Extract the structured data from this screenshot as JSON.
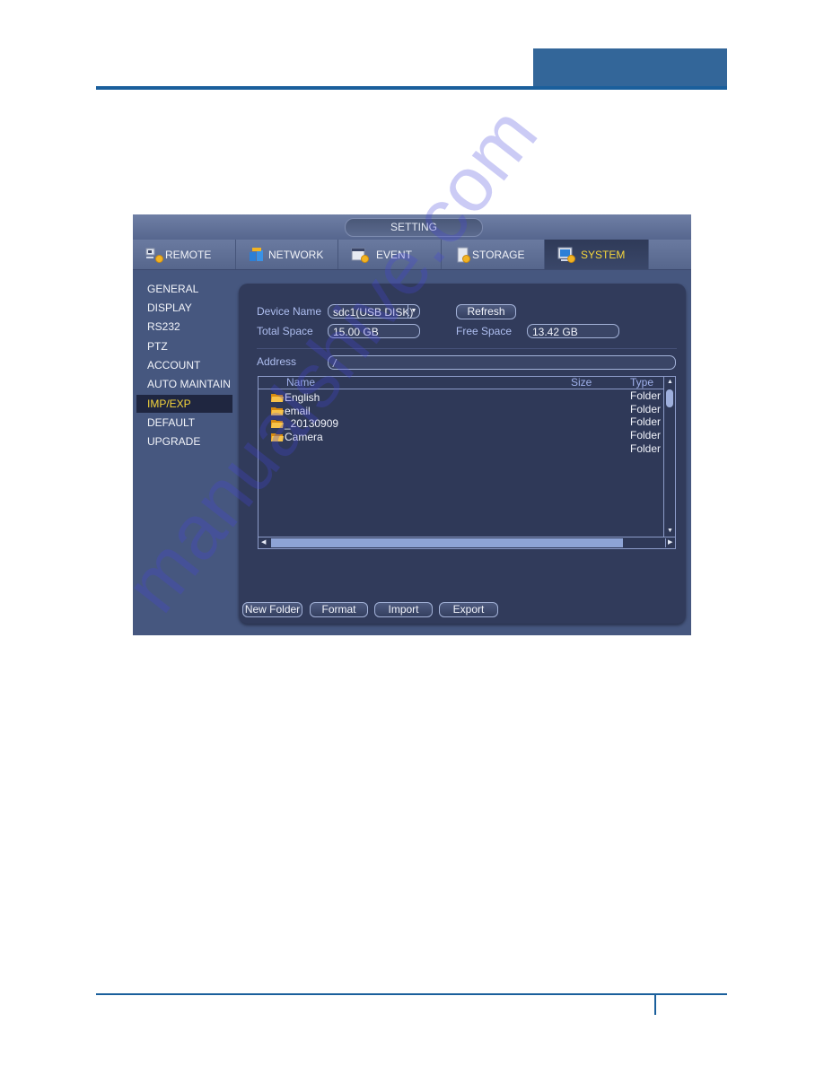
{
  "page": {
    "watermark": "manualshive.com"
  },
  "window": {
    "title": "SETTING",
    "tabs": [
      {
        "label": "REMOTE",
        "icon": "remote-icon",
        "active": false
      },
      {
        "label": "NETWORK",
        "icon": "network-icon",
        "active": false
      },
      {
        "label": "EVENT",
        "icon": "event-icon",
        "active": false
      },
      {
        "label": "STORAGE",
        "icon": "storage-icon",
        "active": false
      },
      {
        "label": "SYSTEM",
        "icon": "system-icon",
        "active": true
      }
    ],
    "sidebar": [
      {
        "label": "GENERAL"
      },
      {
        "label": "DISPLAY"
      },
      {
        "label": "RS232"
      },
      {
        "label": "PTZ"
      },
      {
        "label": "ACCOUNT"
      },
      {
        "label": "AUTO MAINTAIN"
      },
      {
        "label": "IMP/EXP",
        "active": true
      },
      {
        "label": "DEFAULT"
      },
      {
        "label": "UPGRADE"
      }
    ],
    "form": {
      "device_name_label": "Device Name",
      "device_name_value": "sdc1(USB DISK)",
      "refresh_label": "Refresh",
      "total_space_label": "Total Space",
      "total_space_value": "15.00 GB",
      "free_space_label": "Free Space",
      "free_space_value": "13.42 GB",
      "address_label": "Address",
      "address_value": "/"
    },
    "file_list": {
      "columns": {
        "name": "Name",
        "size": "Size",
        "type": "Type"
      },
      "rows": [
        {
          "name": "English",
          "size": "",
          "type": "Folder"
        },
        {
          "name": "email",
          "size": "",
          "type": "Folder"
        },
        {
          "name": "_20130909",
          "size": "",
          "type": "Folder"
        },
        {
          "name": "Camera",
          "size": "",
          "type": "Folder"
        },
        {
          "name": "",
          "size": "",
          "type": "Folder"
        }
      ]
    },
    "buttons": {
      "new_folder": "New Folder",
      "format": "Format",
      "import": "Import",
      "export": "Export"
    }
  },
  "colors": {
    "accent": "#f6d63c",
    "doc_blue": "#1a5f9c",
    "header_block": "#336699"
  }
}
